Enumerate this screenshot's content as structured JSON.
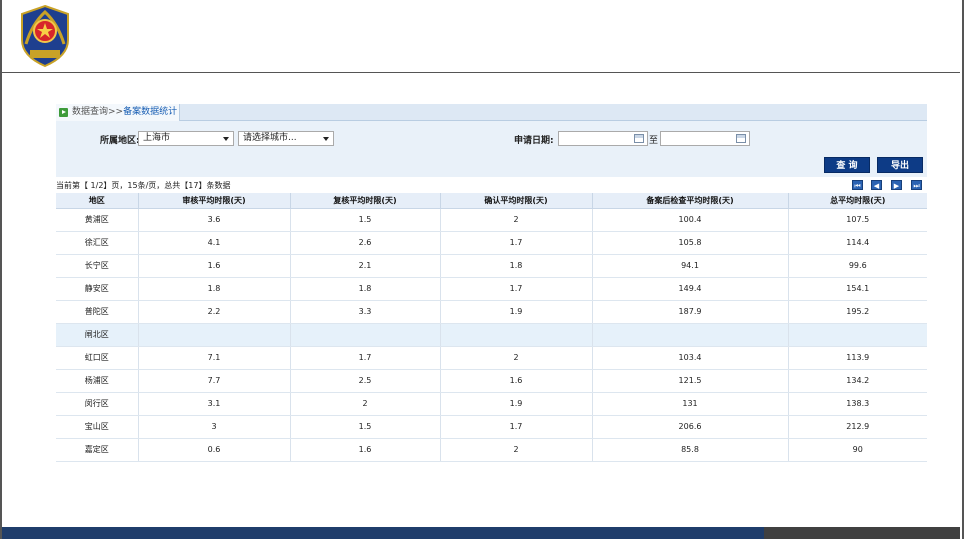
{
  "breadcrumb": {
    "root": "数据查询",
    "sep": ">>",
    "current": "备案数据统计"
  },
  "filter": {
    "region_label": "所属地区:",
    "province_value": "上海市",
    "city_placeholder": "请选择城市...",
    "date_label": "申请日期:",
    "date_to": "至",
    "query_button": "查 询",
    "export_button": "导出"
  },
  "pager": {
    "summary": "当前第【 1/2】页，15条/页，总共【17】条数据",
    "first": "⏮",
    "prev": "◀",
    "next": "▶",
    "last": "⏭"
  },
  "table": {
    "headers": [
      "地区",
      "审核平均时限(天)",
      "复核平均时限(天)",
      "确认平均时限(天)",
      "备案后检查平均时限(天)",
      "总平均时限(天)"
    ],
    "rows": [
      [
        "黄浦区",
        "3.6",
        "1.5",
        "2",
        "100.4",
        "107.5"
      ],
      [
        "徐汇区",
        "4.1",
        "2.6",
        "1.7",
        "105.8",
        "114.4"
      ],
      [
        "长宁区",
        "1.6",
        "2.1",
        "1.8",
        "94.1",
        "99.6"
      ],
      [
        "静安区",
        "1.8",
        "1.8",
        "1.7",
        "149.4",
        "154.1"
      ],
      [
        "普陀区",
        "2.2",
        "3.3",
        "1.9",
        "187.9",
        "195.2"
      ],
      [
        "闸北区",
        "",
        "",
        "",
        "",
        ""
      ],
      [
        "虹口区",
        "7.1",
        "1.7",
        "2",
        "103.4",
        "113.9"
      ],
      [
        "杨浦区",
        "7.7",
        "2.5",
        "1.6",
        "121.5",
        "134.2"
      ],
      [
        "闵行区",
        "3.1",
        "2",
        "1.9",
        "131",
        "138.3"
      ],
      [
        "宝山区",
        "3",
        "1.5",
        "1.7",
        "206.6",
        "212.9"
      ],
      [
        "嘉定区",
        "0.6",
        "1.6",
        "2",
        "85.8",
        "90"
      ]
    ],
    "highlighted_row": 5
  },
  "emblem_text": "上海市公安局",
  "colors": {
    "button": "#0d3b86",
    "footer": "#1f3d6b",
    "header_bg": "#e6eef8"
  }
}
